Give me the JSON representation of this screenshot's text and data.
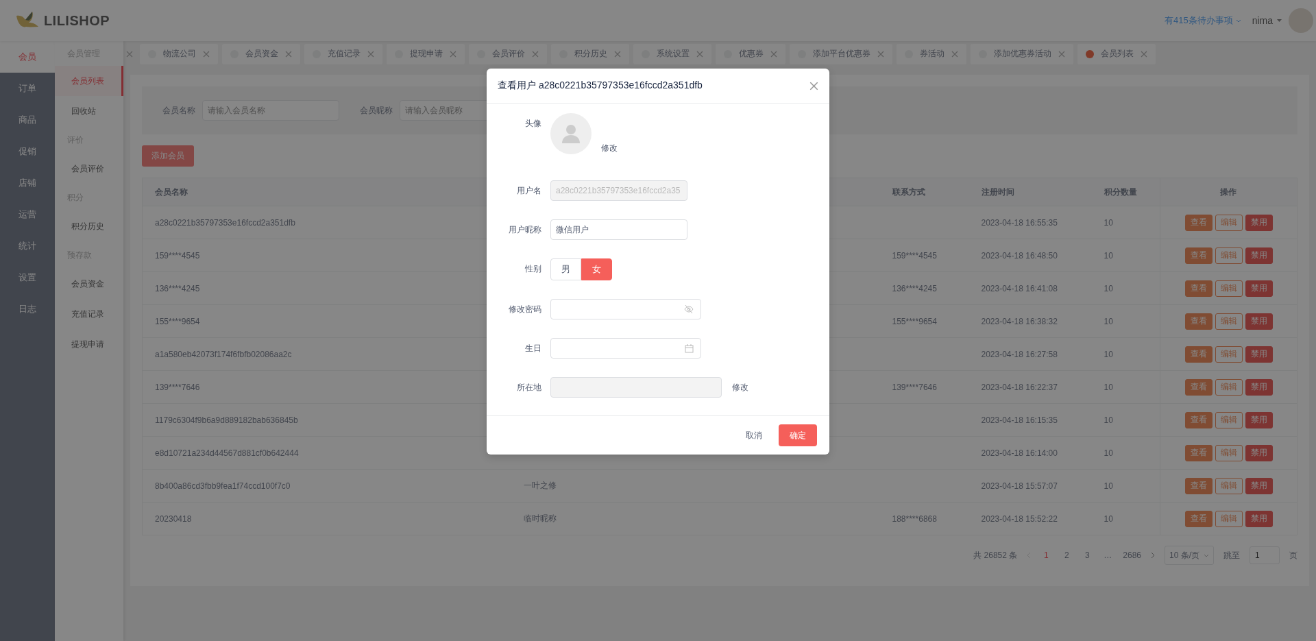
{
  "header": {
    "brand": "LILISHOP",
    "todo": "有415条待办事项",
    "user": "nima"
  },
  "nav": [
    {
      "label": "会员",
      "selected": true
    },
    {
      "label": "订单",
      "selected": false
    },
    {
      "label": "商品",
      "selected": false
    },
    {
      "label": "促销",
      "selected": false
    },
    {
      "label": "店铺",
      "selected": false
    },
    {
      "label": "运营",
      "selected": false
    },
    {
      "label": "统计",
      "selected": false
    },
    {
      "label": "设置",
      "selected": false
    },
    {
      "label": "日志",
      "selected": false
    }
  ],
  "subnav": [
    {
      "kind": "group",
      "label": "会员管理"
    },
    {
      "kind": "item",
      "label": "会员列表",
      "selected": true
    },
    {
      "kind": "item",
      "label": "回收站",
      "selected": false
    },
    {
      "kind": "group",
      "label": "评价"
    },
    {
      "kind": "item",
      "label": "会员评价",
      "selected": false
    },
    {
      "kind": "group",
      "label": "积分"
    },
    {
      "kind": "item",
      "label": "积分历史",
      "selected": false
    },
    {
      "kind": "group",
      "label": "预存款"
    },
    {
      "kind": "item",
      "label": "会员资金",
      "selected": false
    },
    {
      "kind": "item",
      "label": "充值记录",
      "selected": false
    },
    {
      "kind": "item",
      "label": "提现申请",
      "selected": false
    }
  ],
  "tabs": [
    {
      "label": "物流公司",
      "selected": false
    },
    {
      "label": "会员资金",
      "selected": false
    },
    {
      "label": "充值记录",
      "selected": false
    },
    {
      "label": "提现申请",
      "selected": false
    },
    {
      "label": "会员评价",
      "selected": false
    },
    {
      "label": "积分历史",
      "selected": false
    },
    {
      "label": "系统设置",
      "selected": false
    },
    {
      "label": "优惠券",
      "selected": false
    },
    {
      "label": "添加平台优惠券",
      "selected": false
    },
    {
      "label": "券活动",
      "selected": false
    },
    {
      "label": "添加优惠券活动",
      "selected": false
    },
    {
      "label": "会员列表",
      "selected": true
    }
  ],
  "search": [
    {
      "label": "会员名称",
      "placeholder": "请输入会员名称"
    },
    {
      "label": "会员昵称",
      "placeholder": "请输入会员昵称"
    }
  ],
  "add_button": "添加会员",
  "table": {
    "columns": [
      "会员名称",
      "联系方式",
      "注册时间",
      "积分数量",
      "操作"
    ],
    "rows": [
      {
        "name": "a28c0221b35797353e16fccd2a351dfb",
        "time": "2023-04-18 16:55:35",
        "points": "10",
        "actions": [
          {
            "label": "查看",
            "kind": "primary"
          },
          {
            "label": "编辑",
            "kind": "outline"
          },
          {
            "label": "禁用",
            "kind": "danger"
          }
        ]
      },
      {
        "name": "159****4545",
        "contact": "159****4545",
        "time": "2023-04-18 16:48:50",
        "points": "10",
        "actions": [
          {
            "label": "查看",
            "kind": "primary"
          },
          {
            "label": "编辑",
            "kind": "outline"
          },
          {
            "label": "禁用",
            "kind": "danger"
          }
        ]
      },
      {
        "name": "136****4245",
        "contact": "136****4245",
        "time": "2023-04-18 16:41:08",
        "points": "10",
        "actions": [
          {
            "label": "查看",
            "kind": "primary"
          },
          {
            "label": "编辑",
            "kind": "outline"
          },
          {
            "label": "禁用",
            "kind": "danger"
          }
        ]
      },
      {
        "name": "155****9654",
        "contact": "155****9654",
        "time": "2023-04-18 16:38:32",
        "points": "10",
        "actions": [
          {
            "label": "查看",
            "kind": "primary"
          },
          {
            "label": "编辑",
            "kind": "outline"
          },
          {
            "label": "禁用",
            "kind": "danger"
          }
        ]
      },
      {
        "name": "a1a580eb42073f174f6fbfb02086aa2c",
        "time": "2023-04-18 16:27:58",
        "points": "10",
        "actions": [
          {
            "label": "查看",
            "kind": "primary"
          },
          {
            "label": "编辑",
            "kind": "outline"
          },
          {
            "label": "禁用",
            "kind": "danger"
          }
        ]
      },
      {
        "name": "139****7646",
        "contact": "139****7646",
        "time": "2023-04-18 16:22:37",
        "points": "10",
        "actions": [
          {
            "label": "查看",
            "kind": "primary"
          },
          {
            "label": "编辑",
            "kind": "outline"
          },
          {
            "label": "禁用",
            "kind": "danger"
          }
        ]
      },
      {
        "name": "1179c6304f9b6a9d889182bab636845b",
        "time": "2023-04-18 16:15:35",
        "points": "10",
        "actions": [
          {
            "label": "查看",
            "kind": "primary"
          },
          {
            "label": "编辑",
            "kind": "outline"
          },
          {
            "label": "禁用",
            "kind": "danger"
          }
        ]
      },
      {
        "name": "e8d10721a234d44567d881cf0b642444",
        "time": "2023-04-18 16:14:00",
        "points": "10",
        "actions": [
          {
            "label": "查看",
            "kind": "primary"
          },
          {
            "label": "编辑",
            "kind": "outline"
          },
          {
            "label": "禁用",
            "kind": "danger"
          }
        ]
      },
      {
        "name": "8b400a86cd3fbb9fea1f74ccd100f7c0",
        "nickname": "一叶之修",
        "time": "2023-04-18 15:57:07",
        "points": "10",
        "actions": [
          {
            "label": "查看",
            "kind": "primary"
          },
          {
            "label": "编辑",
            "kind": "outline"
          },
          {
            "label": "禁用",
            "kind": "danger"
          }
        ]
      },
      {
        "name": "20230418",
        "nickname": "临时昵称",
        "contact": "188****6868",
        "time": "2023-04-18 15:52:22",
        "points": "10",
        "actions": [
          {
            "label": "查看",
            "kind": "primary"
          },
          {
            "label": "编辑",
            "kind": "outline"
          },
          {
            "label": "禁用",
            "kind": "danger"
          }
        ]
      }
    ]
  },
  "pagination": {
    "total": "共 26852 条",
    "pages": [
      {
        "label": "1",
        "selected": true
      },
      {
        "label": "2",
        "selected": false
      },
      {
        "label": "3",
        "selected": false
      },
      {
        "label": "…",
        "selected": false
      },
      {
        "label": "2686",
        "selected": false
      }
    ],
    "page_size": "10 条/页",
    "jump_label": "跳至",
    "jump_value": "1",
    "jump_suffix": "页"
  },
  "dialog": {
    "title": "查看用户 a28c0221b35797353e16fccd2a351dfb",
    "fields": [
      {
        "kind": "avatar",
        "label": "头像",
        "action": "修改"
      },
      {
        "kind": "input",
        "label": "用户名",
        "value": "a28c0221b35797353e16fccd2a35",
        "disabled": true
      },
      {
        "kind": "input",
        "label": "用户昵称",
        "value": "微信用户",
        "disabled": false
      },
      {
        "kind": "radio",
        "label": "性别",
        "options": [
          {
            "label": "男",
            "selected": false
          },
          {
            "label": "女",
            "selected": true
          }
        ]
      },
      {
        "kind": "password",
        "label": "修改密码"
      },
      {
        "kind": "date",
        "label": "生日"
      },
      {
        "kind": "region",
        "label": "所在地",
        "action": "修改"
      }
    ],
    "buttons": [
      {
        "label": "取消",
        "kind": "text"
      },
      {
        "label": "确定",
        "kind": "primary"
      }
    ]
  }
}
